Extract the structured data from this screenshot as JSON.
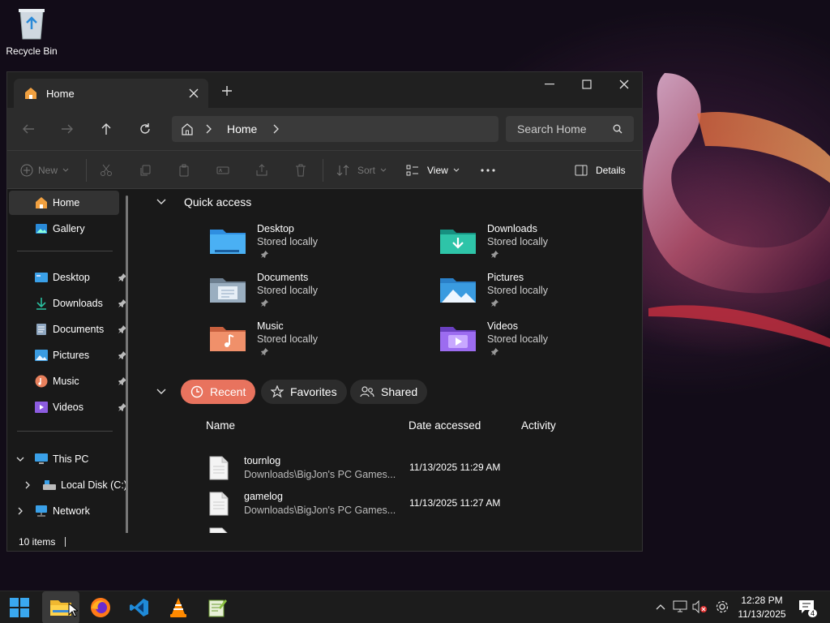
{
  "desktop": {
    "recycle_bin": "Recycle Bin"
  },
  "window": {
    "tab_title": "Home",
    "new_tab_icon": "plus-icon",
    "address": {
      "crumb": "Home"
    },
    "search_placeholder": "Search Home",
    "commands": {
      "new": "New",
      "sort": "Sort",
      "view": "View",
      "details": "Details"
    }
  },
  "sidebar": {
    "pinned_top": [
      {
        "label": "Home",
        "icon": "home-icon",
        "active": true
      },
      {
        "label": "Gallery",
        "icon": "gallery-icon"
      }
    ],
    "quick": [
      {
        "label": "Desktop"
      },
      {
        "label": "Downloads"
      },
      {
        "label": "Documents"
      },
      {
        "label": "Pictures"
      },
      {
        "label": "Music"
      },
      {
        "label": "Videos"
      }
    ],
    "this_pc": "This PC",
    "local_disk": "Local Disk (C:)",
    "network": "Network"
  },
  "main": {
    "quick_access_title": "Quick access",
    "quick_access": [
      {
        "name": "Desktop",
        "sub": "Stored locally",
        "color": "#2f8ee0"
      },
      {
        "name": "Downloads",
        "sub": "Stored locally",
        "color": "#1ea48c"
      },
      {
        "name": "Documents",
        "sub": "Stored locally",
        "color": "#7c8ea0"
      },
      {
        "name": "Pictures",
        "sub": "Stored locally",
        "color": "#3a9be0"
      },
      {
        "name": "Music",
        "sub": "Stored locally",
        "color": "#e8805c"
      },
      {
        "name": "Videos",
        "sub": "Stored locally",
        "color": "#8c5ce0"
      }
    ],
    "tabs": {
      "recent": "Recent",
      "favorites": "Favorites",
      "shared": "Shared"
    },
    "columns": {
      "name": "Name",
      "date": "Date accessed",
      "activity": "Activity"
    },
    "recent": [
      {
        "name": "tournlog",
        "path": "Downloads\\BigJon's PC Games...",
        "date": "11/13/2025 11:29 AM"
      },
      {
        "name": "gamelog",
        "path": "Downloads\\BigJon's PC Games...",
        "date": "11/13/2025 11:27 AM"
      }
    ]
  },
  "status": {
    "items": "10 items"
  },
  "taskbar": {
    "time": "12:28 PM",
    "date": "11/13/2025",
    "notif_count": "4"
  }
}
